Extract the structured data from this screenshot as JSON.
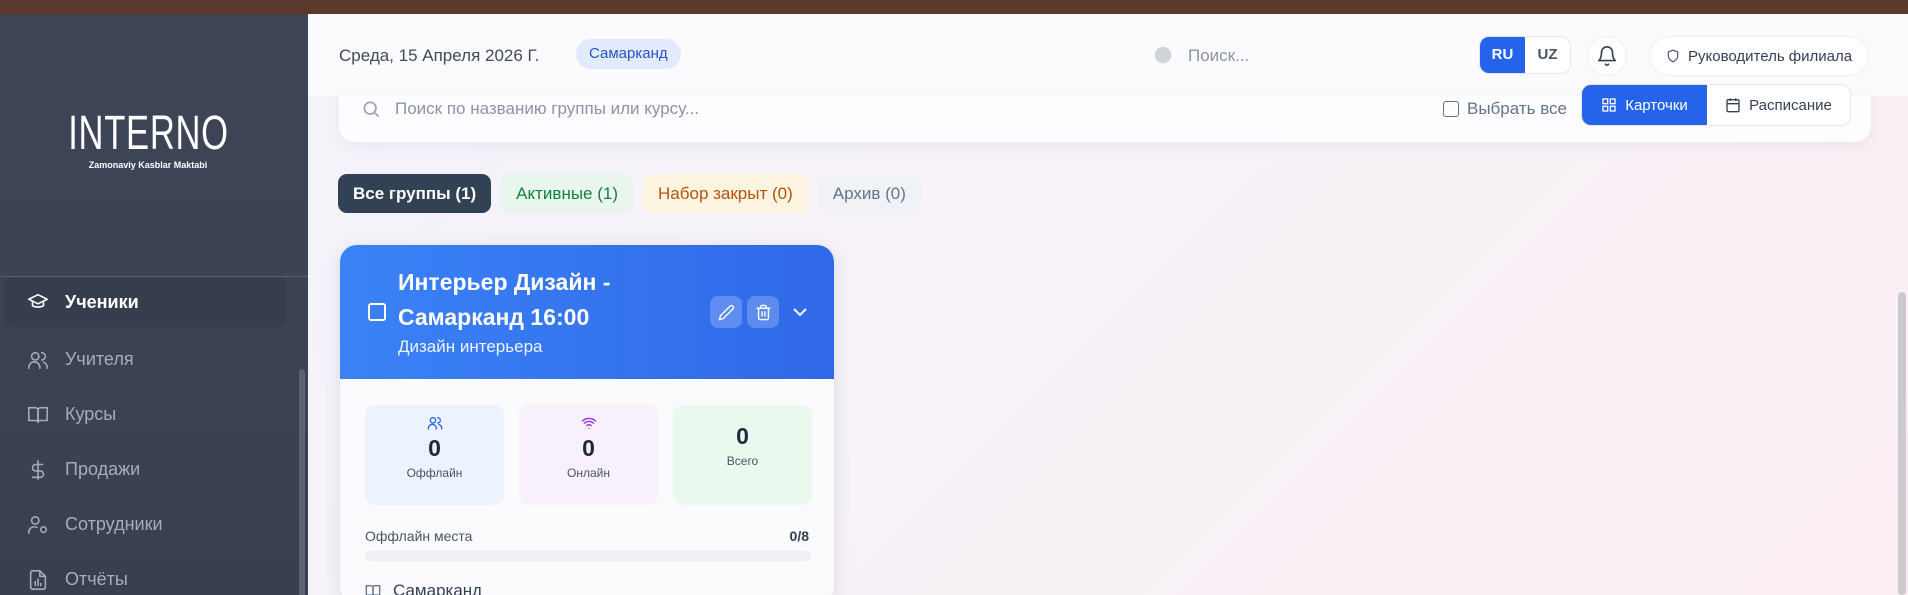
{
  "header": {
    "date": "Среда, 15 Апреля 2026 Г.",
    "city": "Самарканд",
    "search_placeholder": "Поиск...",
    "lang_ru": "RU",
    "lang_uz": "UZ",
    "role": "Руководитель филиала"
  },
  "sidebar": {
    "logo_word": "INTERNO",
    "logo_sub": "Zamonaviy Kasblar Maktabi",
    "items": [
      {
        "label": "Ученики",
        "icon": "graduation-cap-icon",
        "active": true
      },
      {
        "label": "Учителя",
        "icon": "users-icon"
      },
      {
        "label": "Курсы",
        "icon": "book-open-icon"
      },
      {
        "label": "Продажи",
        "icon": "dollar-icon"
      },
      {
        "label": "Сотрудники",
        "icon": "user-cog-icon"
      },
      {
        "label": "Отчёты",
        "icon": "report-icon"
      }
    ]
  },
  "filters": {
    "search_placeholder": "Поиск по названию группы или курсу...",
    "select_all": "Выбрать все",
    "view_cards": "Карточки",
    "view_schedule": "Расписание"
  },
  "tabs": [
    {
      "label": "Все группы (1)"
    },
    {
      "label": "Активные (1)"
    },
    {
      "label": "Набор закрыт (0)"
    },
    {
      "label": "Архив (0)"
    }
  ],
  "group_card": {
    "title": "Интерьер Дизайн - Самарканд 16:00",
    "course": "Дизайн интерьера",
    "stats": [
      {
        "value": "0",
        "label": "Оффлайн"
      },
      {
        "value": "0",
        "label": "Онлайн"
      },
      {
        "value": "0",
        "label": "Всего"
      }
    ],
    "seats_label": "Оффлайн места",
    "seats_value": "0/8",
    "seats_fill": 0,
    "branch": "Самарканд"
  },
  "colors": {
    "accent": "#2563eb",
    "sidebar_bg": "#3d4556",
    "active_tab": "#334155"
  }
}
